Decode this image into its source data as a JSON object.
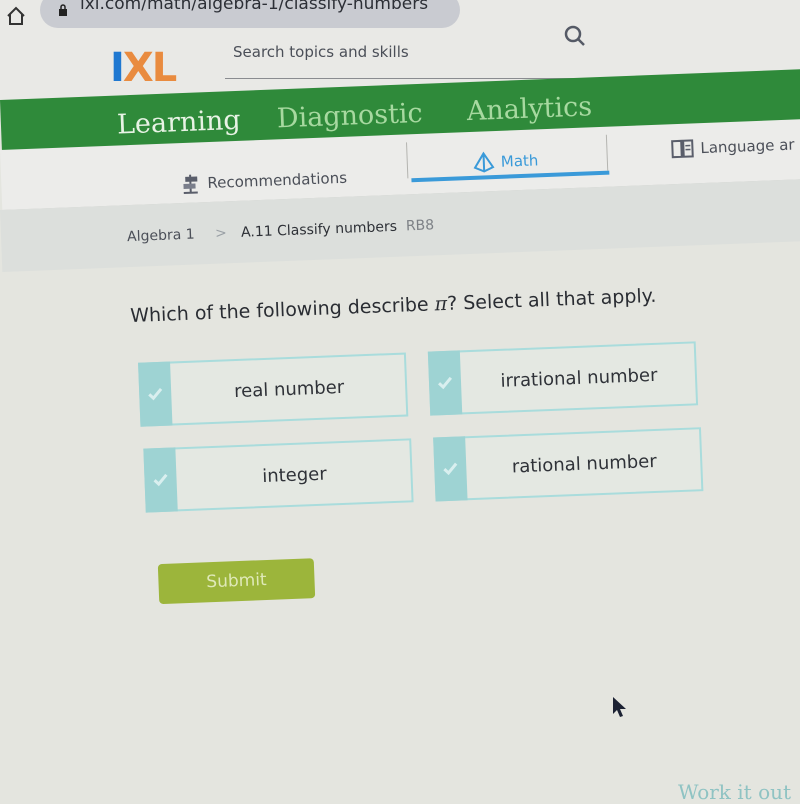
{
  "browser": {
    "url": "ixl.com/math/algebra-1/classify-numbers"
  },
  "header": {
    "logo_i": "I",
    "logo_xl": "XL",
    "search_placeholder": "Search topics and skills"
  },
  "nav": {
    "items": [
      {
        "label": "Learning",
        "active": true
      },
      {
        "label": "Diagnostic",
        "active": false
      },
      {
        "label": "Analytics",
        "active": false
      }
    ]
  },
  "subject_tabs": {
    "items": [
      {
        "label": "Recommendations",
        "icon": "signpost-icon",
        "active": false
      },
      {
        "label": "Math",
        "icon": "pyramid-icon",
        "active": true
      },
      {
        "label": "Language ar",
        "icon": "book-icon",
        "active": false
      }
    ]
  },
  "breadcrumb": {
    "course": "Algebra 1",
    "separator": ">",
    "skill": "A.11 Classify numbers",
    "code": "RB8"
  },
  "question": {
    "prompt_before": "Which of the following describe ",
    "symbol": "π",
    "prompt_after": "? Select all that apply.",
    "choices": [
      {
        "label": "real number",
        "selected": false
      },
      {
        "label": "irrational number",
        "selected": false
      },
      {
        "label": "integer",
        "selected": false
      },
      {
        "label": "rational number",
        "selected": false
      }
    ],
    "submit_label": "Submit"
  },
  "footer": {
    "work_it_out": "Work it out"
  },
  "colors": {
    "brand_green": "#2f8a3a",
    "logo_blue": "#1f78d1",
    "logo_orange": "#e98b3f",
    "accent_blue": "#3a9ad9",
    "choice_teal": "#9ed3d3",
    "submit_green": "#9cb53b"
  }
}
